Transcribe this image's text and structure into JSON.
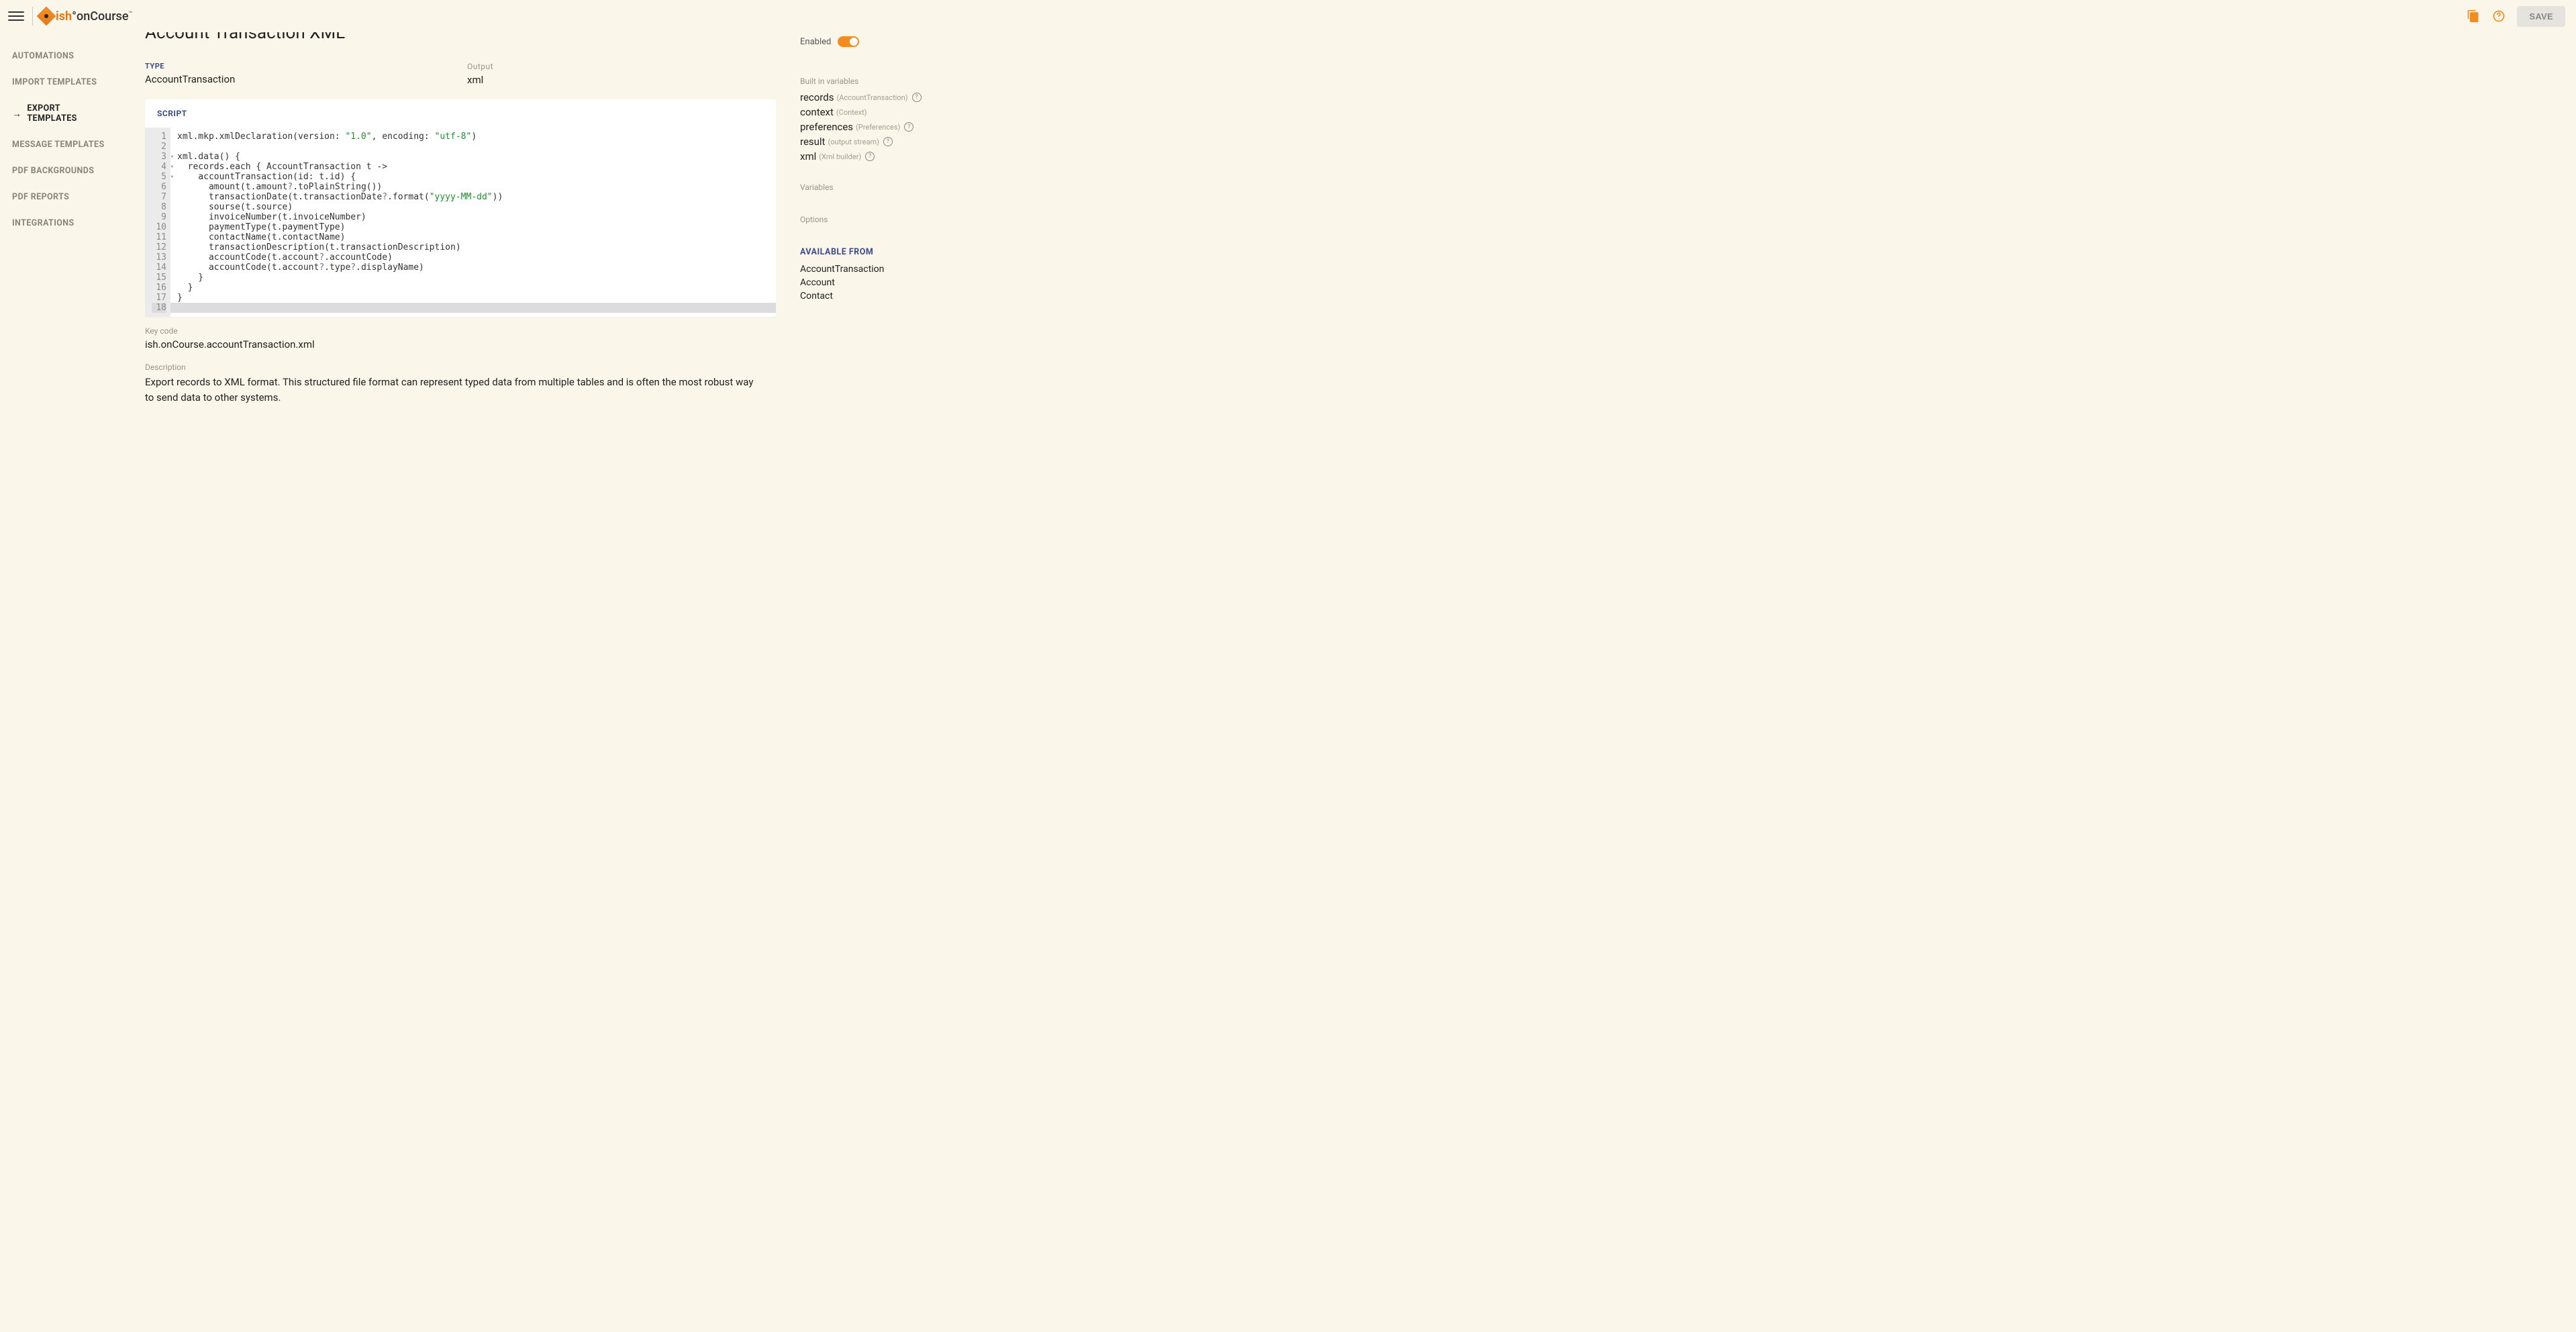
{
  "header": {
    "logo_ish": "ish",
    "logo_rest": "onCourse",
    "save_label": "SAVE"
  },
  "sidebar": {
    "items": [
      {
        "label": "AUTOMATIONS",
        "active": false
      },
      {
        "label": "IMPORT TEMPLATES",
        "active": false
      },
      {
        "label": "EXPORT TEMPLATES",
        "active": true
      },
      {
        "label": "MESSAGE TEMPLATES",
        "active": false
      },
      {
        "label": "PDF BACKGROUNDS",
        "active": false
      },
      {
        "label": "PDF REPORTS",
        "active": false
      },
      {
        "label": "INTEGRATIONS",
        "active": false
      }
    ]
  },
  "page": {
    "title": "Account Transaction XML",
    "type_label": "TYPE",
    "type_value": "AccountTransaction",
    "output_label": "Output",
    "output_value": "xml",
    "script_label": "SCRIPT",
    "code_lines": [
      {
        "n": 1,
        "fold": false,
        "raw": "xml.mkp.xmlDeclaration(version: \"1.0\", encoding: \"utf-8\")",
        "segments": [
          [
            "xml.mkp.xmlDeclaration(version: ",
            ""
          ],
          [
            "\"1.0\"",
            "str"
          ],
          [
            ", encoding: ",
            ""
          ],
          [
            "\"utf-8\"",
            "str"
          ],
          [
            ")",
            ""
          ]
        ]
      },
      {
        "n": 2,
        "fold": false,
        "raw": "",
        "segments": [
          [
            "",
            ""
          ]
        ]
      },
      {
        "n": 3,
        "fold": true,
        "raw": "xml.data() {",
        "segments": [
          [
            "xml.data() {",
            ""
          ]
        ]
      },
      {
        "n": 4,
        "fold": true,
        "raw": "  records.each { AccountTransaction t ->",
        "segments": [
          [
            "  records.each { AccountTransaction t ->",
            ""
          ]
        ]
      },
      {
        "n": 5,
        "fold": true,
        "raw": "    accountTransaction(id: t.id) {",
        "segments": [
          [
            "    accountTransaction(id: t.id) {",
            ""
          ]
        ]
      },
      {
        "n": 6,
        "fold": false,
        "raw": "      amount(t.amount?.toPlainString())",
        "segments": [
          [
            "      amount(t.amount",
            ""
          ],
          [
            "?",
            "op"
          ],
          [
            ".toPlainString())",
            ""
          ]
        ]
      },
      {
        "n": 7,
        "fold": false,
        "raw": "      transactionDate(t.transactionDate?.format(\"yyyy-MM-dd\"))",
        "segments": [
          [
            "      transactionDate(t.transactionDate",
            ""
          ],
          [
            "?",
            "op"
          ],
          [
            ".format(",
            ""
          ],
          [
            "\"yyyy-MM-dd\"",
            "str"
          ],
          [
            "))",
            ""
          ]
        ]
      },
      {
        "n": 8,
        "fold": false,
        "raw": "      sourse(t.source)",
        "segments": [
          [
            "      sourse(t.source)",
            ""
          ]
        ]
      },
      {
        "n": 9,
        "fold": false,
        "raw": "      invoiceNumber(t.invoiceNumber)",
        "segments": [
          [
            "      invoiceNumber(t.invoiceNumber)",
            ""
          ]
        ]
      },
      {
        "n": 10,
        "fold": false,
        "raw": "      paymentType(t.paymentType)",
        "segments": [
          [
            "      paymentType(t.paymentType)",
            ""
          ]
        ]
      },
      {
        "n": 11,
        "fold": false,
        "raw": "      contactName(t.contactName)",
        "segments": [
          [
            "      contactName(t.contactName)",
            ""
          ]
        ]
      },
      {
        "n": 12,
        "fold": false,
        "raw": "      transactionDescription(t.transactionDescription)",
        "segments": [
          [
            "      transactionDescription(t.transactionDescription)",
            ""
          ]
        ]
      },
      {
        "n": 13,
        "fold": false,
        "raw": "      accountCode(t.account?.accountCode)",
        "segments": [
          [
            "      accountCode(t.account",
            ""
          ],
          [
            "?",
            "op"
          ],
          [
            ".accountCode)",
            ""
          ]
        ]
      },
      {
        "n": 14,
        "fold": false,
        "raw": "      accountCode(t.account?.type?.displayName)",
        "segments": [
          [
            "      accountCode(t.account",
            ""
          ],
          [
            "?",
            "op"
          ],
          [
            ".type",
            ""
          ],
          [
            "?",
            "op"
          ],
          [
            ".displayName)",
            ""
          ]
        ]
      },
      {
        "n": 15,
        "fold": false,
        "raw": "    }",
        "segments": [
          [
            "    }",
            ""
          ]
        ]
      },
      {
        "n": 16,
        "fold": false,
        "raw": "  }",
        "segments": [
          [
            "  }",
            ""
          ]
        ]
      },
      {
        "n": 17,
        "fold": false,
        "raw": "}",
        "segments": [
          [
            "}",
            ""
          ]
        ]
      },
      {
        "n": 18,
        "fold": false,
        "raw": "",
        "segments": [
          [
            "",
            ""
          ]
        ],
        "last": true
      }
    ],
    "keycode_label": "Key code",
    "keycode_value": "ish.onCourse.accountTransaction.xml",
    "description_label": "Description",
    "description_value": "Export records to XML format. This structured file format can represent typed data from multiple tables and is often the most robust way to send data to other systems."
  },
  "panel": {
    "enabled_label": "Enabled",
    "enabled": true,
    "builtin_label": "Built in variables",
    "builtin_vars": [
      {
        "name": "records",
        "type": "(AccountTransaction)",
        "help": true
      },
      {
        "name": "context",
        "type": "(Context)",
        "help": false
      },
      {
        "name": "preferences",
        "type": "(Preferences)",
        "help": true
      },
      {
        "name": "result",
        "type": "(output stream)",
        "help": true
      },
      {
        "name": "xml",
        "type": "(Xml builder)",
        "help": true
      }
    ],
    "variables_label": "Variables",
    "options_label": "Options",
    "available_label": "AVAILABLE FROM",
    "available_items": [
      "AccountTransaction",
      "Account",
      "Contact"
    ]
  }
}
